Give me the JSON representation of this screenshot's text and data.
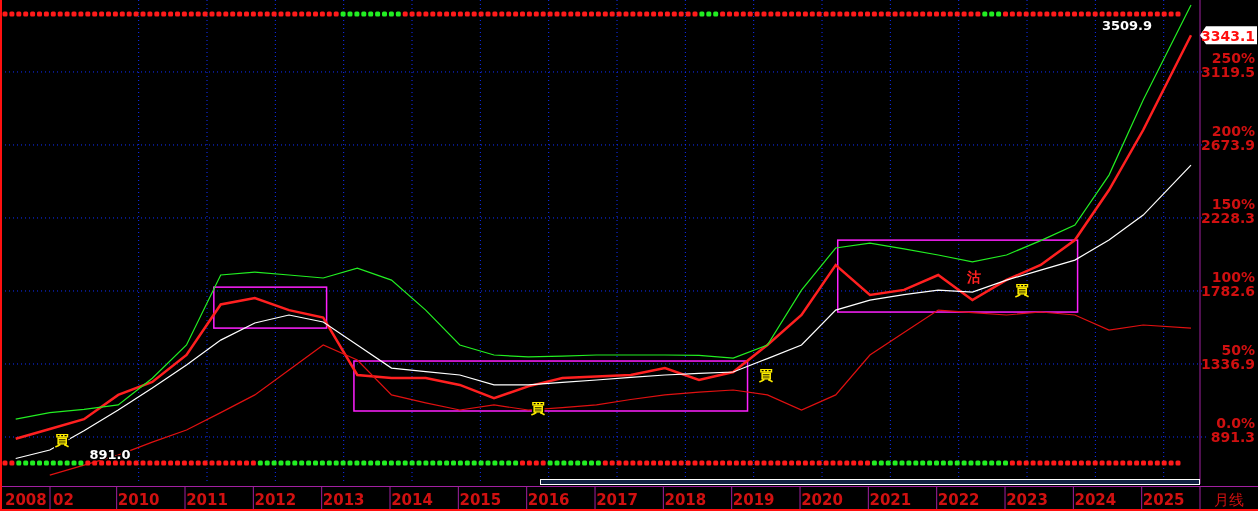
{
  "chart": {
    "current_price": "3343.1",
    "period": "月线",
    "percent_labels": [
      "250%",
      "200%",
      "150%",
      "100%",
      "50%",
      "0.0%"
    ],
    "axis_start_labels": [
      "2008",
      "02"
    ],
    "signals": [
      {
        "kind": "buy",
        "text": "買"
      },
      {
        "kind": "buy",
        "text": "買"
      },
      {
        "kind": "buy",
        "text": "買"
      },
      {
        "kind": "buy",
        "text": "買"
      },
      {
        "kind": "sell",
        "text": "沽"
      },
      {
        "kind": "high",
        "text": "3509.9"
      },
      {
        "kind": "low",
        "text": "891.0"
      }
    ],
    "chart_data": {
      "type": "line",
      "grid": true,
      "x": [
        2008.2,
        2008.7,
        2009.2,
        2009.7,
        2010.2,
        2010.7,
        2011.2,
        2011.7,
        2012.2,
        2012.7,
        2013.2,
        2013.7,
        2014.2,
        2014.7,
        2015.2,
        2015.7,
        2016.2,
        2016.7,
        2017.2,
        2017.7,
        2018.2,
        2018.7,
        2019.2,
        2019.7,
        2020.2,
        2020.7,
        2021.2,
        2021.7,
        2022.2,
        2022.7,
        2023.2,
        2023.7,
        2024.2,
        2024.7,
        2025.4
      ],
      "series": [
        {
          "color": "#ff2020",
          "values": [
            880,
            940,
            1000,
            1148,
            1227,
            1392,
            1700,
            1740,
            1666,
            1620,
            1270,
            1251,
            1251,
            1209,
            1129,
            1200,
            1251,
            1260,
            1270,
            1312,
            1239,
            1288,
            1453,
            1636,
            1941,
            1758,
            1789,
            1880,
            1727,
            1850,
            1941,
            2094,
            2399,
            2765,
            3343.1
          ]
        },
        {
          "color": "#22ee22",
          "values": [
            1000,
            1040,
            1060,
            1087,
            1250,
            1453,
            1880,
            1898,
            1880,
            1862,
            1922,
            1849,
            1666,
            1453,
            1392,
            1380,
            1385,
            1392,
            1392,
            1392,
            1390,
            1373,
            1453,
            1788,
            2045,
            2075,
            2040,
            2002,
            1960,
            2002,
            2090,
            2185,
            2490,
            2948,
            3528
          ]
        },
        {
          "color": "#ffffff",
          "values": [
            760,
            812,
            930,
            1056,
            1190,
            1331,
            1483,
            1587,
            1636,
            1593,
            1453,
            1312,
            1290,
            1270,
            1209,
            1209,
            1225,
            1239,
            1255,
            1270,
            1280,
            1288,
            1370,
            1453,
            1666,
            1727,
            1760,
            1788,
            1776,
            1849,
            1910,
            1971,
            2094,
            2246,
            2551
          ]
        },
        {
          "color": "#e01010",
          "values": [
            null,
            659,
            720,
            781,
            860,
            934,
            1040,
            1148,
            1300,
            1453,
            1361,
            1148,
            1100,
            1056,
            1087,
            1056,
            1070,
            1087,
            1120,
            1148,
            1165,
            1178,
            1148,
            1056,
            1148,
            1392,
            1530,
            1666,
            1650,
            1636,
            1654,
            1636,
            1544,
            1575,
            1556
          ]
        }
      ],
      "xlim": [
        2008,
        2026.38
      ],
      "ylim": [
        451.8,
        3558.7
      ],
      "xticks": [
        2010,
        2011,
        2012,
        2013,
        2014,
        2015,
        2016,
        2017,
        2018,
        2019,
        2020,
        2021,
        2022,
        2023,
        2024,
        2025
      ],
      "yticks": [
        891.3,
        1336.9,
        1782.6,
        2228.3,
        2673.9,
        3119.5
      ]
    }
  }
}
